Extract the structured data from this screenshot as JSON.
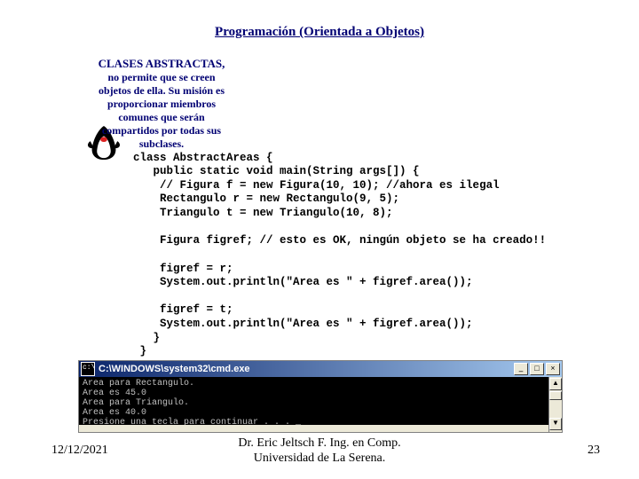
{
  "title": "Programación (Orientada a Objetos)",
  "annotation": {
    "heading": "CLASES ABSTRACTAS,",
    "body": "no permite que se creen objetos de ella. Su misión es proporcionar miembros comunes que serán compartidos por todas sus subclases."
  },
  "code": "class AbstractAreas {\n   public static void main(String args[]) {\n    // Figura f = new Figura(10, 10); //ahora es ilegal\n    Rectangulo r = new Rectangulo(9, 5);\n    Triangulo t = new Triangulo(10, 8);\n\n    Figura figref; // esto es OK, ningún objeto se ha creado!!\n\n    figref = r;\n    System.out.println(\"Area es \" + figref.area());\n\n    figref = t;\n    System.out.println(\"Area es \" + figref.area());\n   }\n }",
  "console": {
    "title": "C:\\WINDOWS\\system32\\cmd.exe",
    "lines": "Area para Rectangulo.\nArea es 45.0\nArea para Triangulo.\nArea es 40.0\nPresione una tecla para continuar . . . _",
    "btn_min": "_",
    "btn_max": "□",
    "btn_close": "×",
    "scroll_up": "▲",
    "scroll_down": "▼"
  },
  "footer": {
    "date": "12/12/2021",
    "center_l1": "Dr. Eric Jeltsch F. Ing. en Comp.",
    "center_l2": "Universidad de La Serena.",
    "page": "23"
  }
}
